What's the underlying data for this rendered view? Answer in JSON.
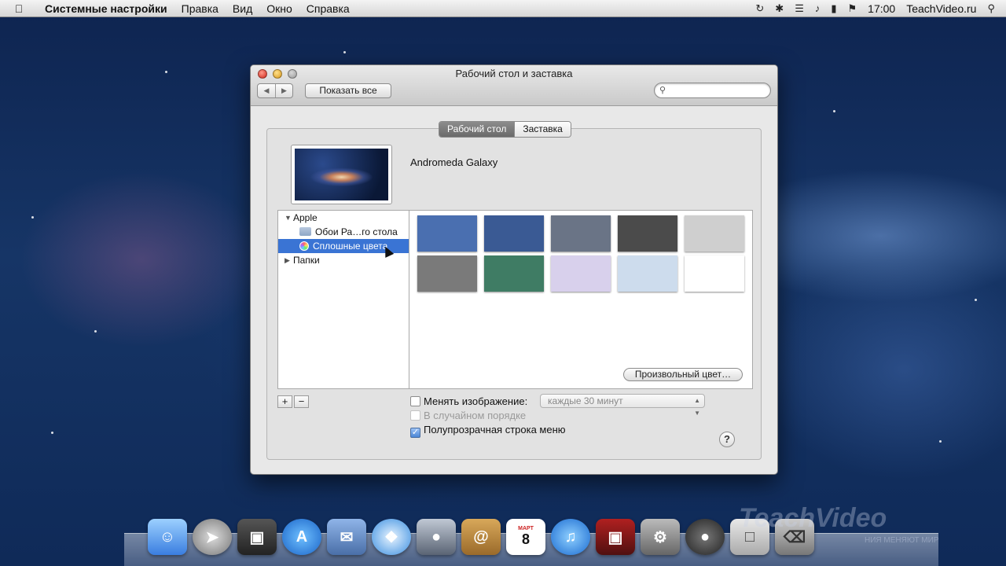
{
  "menubar": {
    "app_name": "Системные настройки",
    "items": [
      "Правка",
      "Вид",
      "Окно",
      "Справка"
    ],
    "clock": "17:00",
    "user": "TeachVideo.ru"
  },
  "window": {
    "title": "Рабочий стол и заставка",
    "show_all": "Показать все",
    "search_placeholder": "",
    "tabs": [
      "Рабочий стол",
      "Заставка"
    ],
    "active_tab": "Рабочий стол",
    "current_picture": "Andromeda Galaxy",
    "sources": {
      "apple_group": "Apple",
      "wallpapers": "Обои Ра…го стола",
      "solid_colors": "Сплошные цвета",
      "folders": "Папки"
    },
    "swatches": [
      "#4a6fb0",
      "#3a5a94",
      "#6a7486",
      "#4b4b4b",
      "#cfcfcf",
      "#7a7a7a",
      "#3f7c64",
      "#d8d0ec",
      "#cddced",
      "#ffffff"
    ],
    "custom_color_button": "Произвольный цвет…",
    "add_label": "+",
    "remove_label": "−",
    "change_picture_label": "Менять изображение:",
    "interval_value": "каждые 30 минут",
    "random_order_label": "В случайном порядке",
    "translucent_menu_label": "Полупрозрачная строка меню",
    "help_label": "?"
  },
  "dock": {
    "calendar_day": "8",
    "calendar_month": "МАРТ"
  },
  "watermark": {
    "brand": "TeachVideo",
    "slogan": "НИЯ МЕНЯЮТ МИР"
  }
}
